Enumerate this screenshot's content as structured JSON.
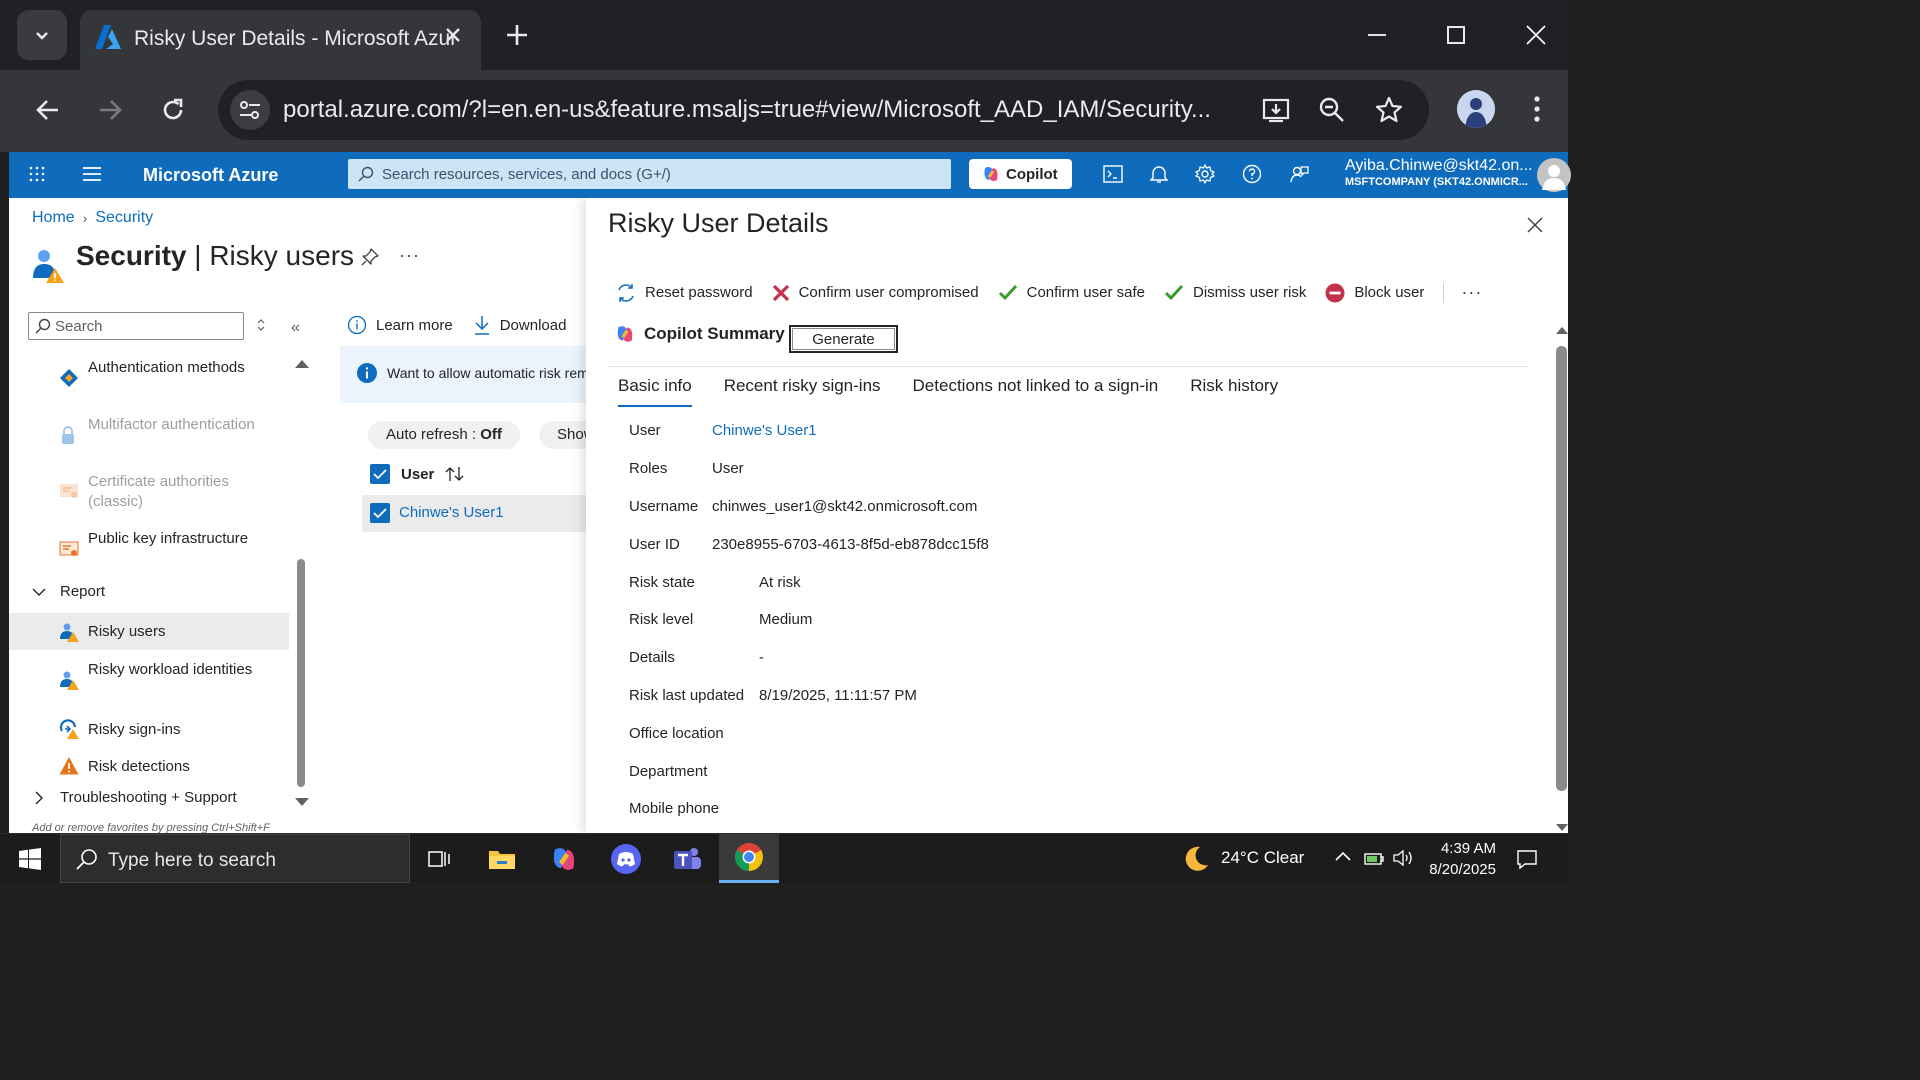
{
  "browser": {
    "tab_title": "Risky User Details - Microsoft Azure",
    "url": "portal.azure.com/?l=en.en-us&feature.msaljs=true#view/Microsoft_AAD_IAM/Security..."
  },
  "azure_header": {
    "brand": "Microsoft Azure",
    "search_placeholder": "Search resources, services, and docs (G+/)",
    "copilot_label": "Copilot",
    "account_name": "Ayiba.Chinwe@skt42.on...",
    "account_org": "MSFTCOMPANY (SKT42.ONMICR..."
  },
  "breadcrumb": {
    "home": "Home",
    "security": "Security"
  },
  "page": {
    "title_bold": "Security",
    "title_rest": " | Risky users",
    "more": "···"
  },
  "left_nav": {
    "search_placeholder": "Search",
    "items": [
      {
        "label": "Authentication methods",
        "disabled": false
      },
      {
        "label": "Multifactor authentication",
        "disabled": true
      },
      {
        "label": "Certificate authorities (classic)",
        "disabled": true
      },
      {
        "label": "Public key infrastructure",
        "disabled": false
      },
      {
        "label": "Report",
        "group": true
      },
      {
        "label": "Risky users",
        "selected": true
      },
      {
        "label": "Risky workload identities"
      },
      {
        "label": "Risky sign-ins"
      },
      {
        "label": "Risk detections"
      },
      {
        "label": "Troubleshooting + Support",
        "group": true
      }
    ],
    "hint": "Add or remove favorites by pressing Ctrl+Shift+F"
  },
  "middle": {
    "learn_more": "Learn more",
    "download": "Download",
    "banner": "Want to allow automatic risk remediation",
    "auto_refresh_label": "Auto refresh : ",
    "auto_refresh_value": "Off",
    "show_pill": "Show dates as",
    "column_user": "User",
    "row_user": "Chinwe's User1"
  },
  "panel": {
    "title": "Risky User Details",
    "commands": {
      "reset": "Reset password",
      "compromised": "Confirm user compromised",
      "safe": "Confirm user safe",
      "dismiss": "Dismiss user risk",
      "block": "Block user",
      "more": "···"
    },
    "copilot_summary": "Copilot Summary",
    "generate": "Generate",
    "tabs": [
      "Basic info",
      "Recent risky sign-ins",
      "Detections not linked to a sign-in",
      "Risk history"
    ],
    "info": {
      "user_k": "User",
      "user_v": "Chinwe's User1",
      "roles_k": "Roles",
      "roles_v": "User",
      "username_k": "Username",
      "username_v": "chinwes_user1@skt42.onmicrosoft.com",
      "userid_k": "User ID",
      "userid_v": "230e8955-6703-4613-8f5d-eb878dcc15f8",
      "riskstate_k": "Risk state",
      "riskstate_v": "At risk",
      "risklevel_k": "Risk level",
      "risklevel_v": "Medium",
      "details_k": "Details",
      "details_v": "-",
      "riskupdated_k": "Risk last updated",
      "riskupdated_v": "8/19/2025, 11:11:57 PM",
      "office_k": "Office location",
      "dept_k": "Department",
      "mobile_k": "Mobile phone"
    }
  },
  "taskbar": {
    "search_placeholder": "Type here to search",
    "weather": "24°C  Clear",
    "time": "4:39 AM",
    "date": "8/20/2025"
  },
  "colors": {
    "azure_blue": "#0f6cbd",
    "chrome_dark": "#202124",
    "chrome_toolbar": "#35363a"
  }
}
